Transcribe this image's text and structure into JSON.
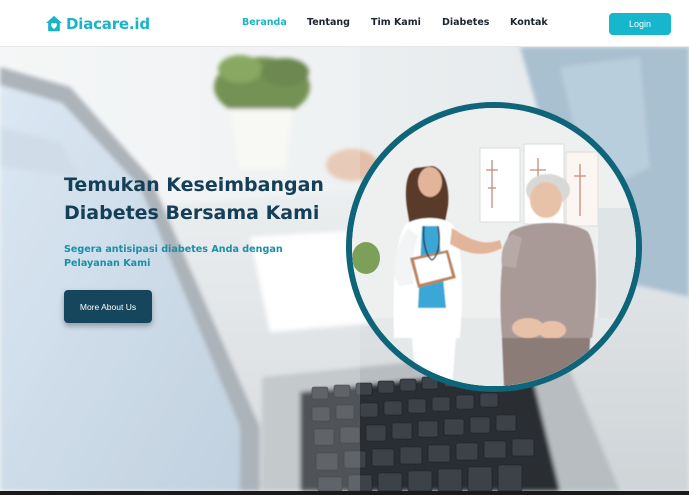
{
  "brand": {
    "name": "Diacare.id",
    "color": "#1ab4c8"
  },
  "nav": {
    "items": [
      {
        "label": "Beranda",
        "active": true
      },
      {
        "label": "Tentang",
        "active": false
      },
      {
        "label": "Tim Kami",
        "active": false
      },
      {
        "label": "Diabetes",
        "active": false
      },
      {
        "label": "Kontak",
        "active": false
      }
    ],
    "login_label": "Login"
  },
  "hero": {
    "title_line1": "Temukan Keseimbangan",
    "title_line2": "Diabetes Bersama Kami",
    "subtitle_line1": "Segera antisipasi diabetes Anda dengan",
    "subtitle_line2": "Pelayanan Kami",
    "button_label": "More About Us",
    "background_image": "doctor-desk-laptop-photo",
    "circle_image": "doctor-with-elderly-patient-photo"
  },
  "colors": {
    "accent": "#16b7cc",
    "heading": "#153f57",
    "subtitle": "#1790a8",
    "button": "#15465c",
    "circle_border": "#0e6478"
  }
}
